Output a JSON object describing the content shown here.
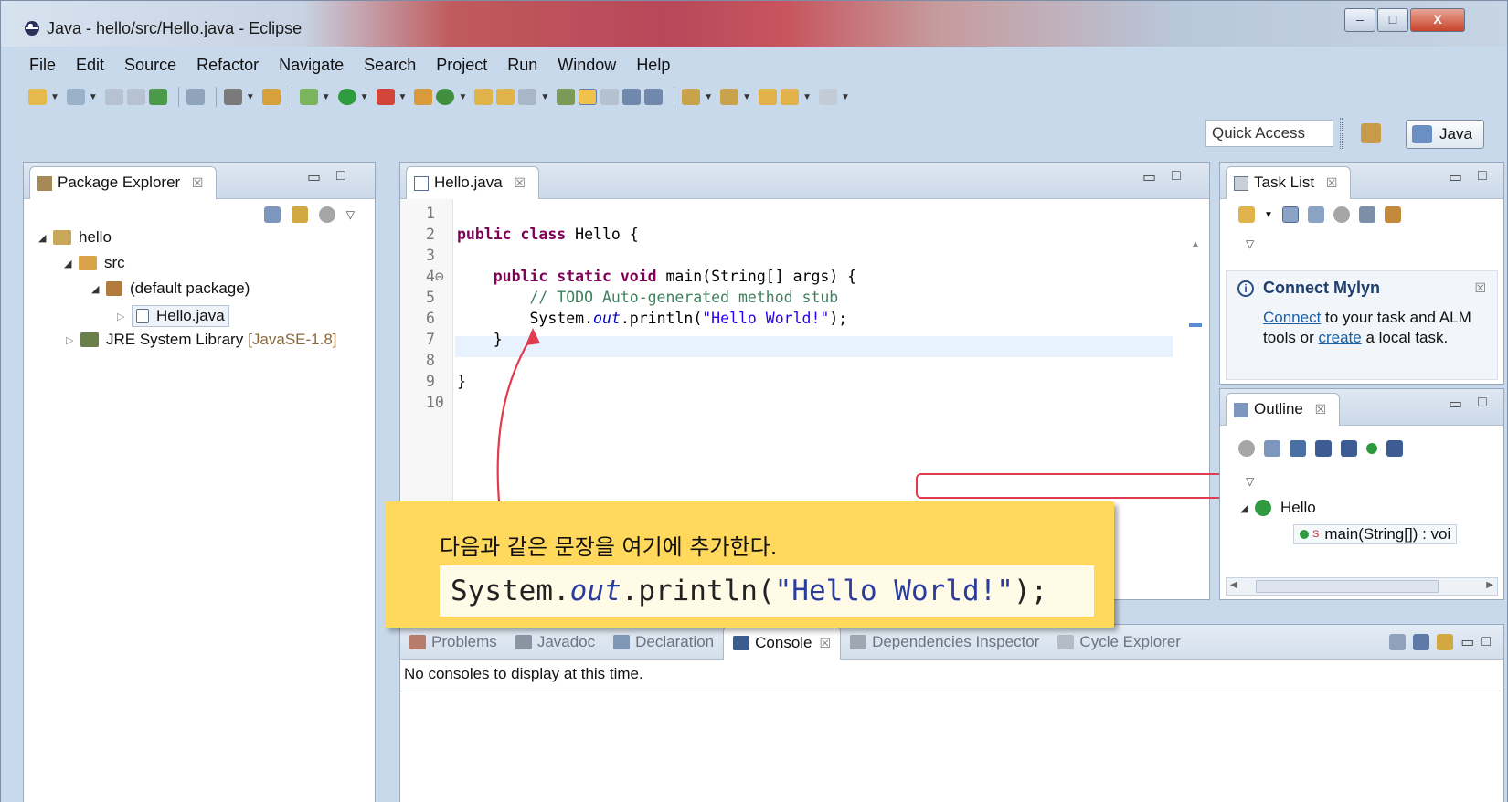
{
  "window": {
    "title": "Java - hello/src/Hello.java - Eclipse",
    "min_symbol": "‒",
    "max_symbol": "□",
    "close_symbol": "X"
  },
  "menu": [
    "File",
    "Edit",
    "Source",
    "Refactor",
    "Navigate",
    "Search",
    "Project",
    "Run",
    "Window",
    "Help"
  ],
  "toolbar": {
    "quick_access_placeholder": "Quick Access",
    "perspective_label": "Java"
  },
  "package_explorer": {
    "tab_label": "Package Explorer",
    "close_symbol": "☒",
    "tree": {
      "project": "hello",
      "src": "src",
      "package": "(default package)",
      "file": "Hello.java",
      "jre": "JRE System Library",
      "jre_version": "[JavaSE-1.8]"
    }
  },
  "editor": {
    "tab_label": "Hello.java",
    "lines": [
      {
        "n": "1"
      },
      {
        "n": "2",
        "kw": "public class ",
        "rest": "Hello {"
      },
      {
        "n": "3"
      },
      {
        "n": "4⊖",
        "kw": "public static void ",
        "rest": "main(String[] args) {"
      },
      {
        "n": "5",
        "comment": "// TODO Auto-generated method stub"
      },
      {
        "n": "6",
        "pre": "System.",
        "field": "out",
        "mid": ".println(",
        "str": "\"Hello World!\"",
        "post": ");"
      },
      {
        "n": "7",
        "rest": "}"
      },
      {
        "n": "8"
      },
      {
        "n": "9",
        "rest": "}"
      },
      {
        "n": "10"
      }
    ]
  },
  "task_list": {
    "tab_label": "Task List",
    "mylyn_title": "Connect Mylyn",
    "mylyn_link1": "Connect",
    "mylyn_text1": " to your task and ALM tools or ",
    "mylyn_link2": "create",
    "mylyn_text2": " a local task."
  },
  "outline": {
    "tab_label": "Outline",
    "class_name": "Hello",
    "method": "main(String[]) : voi"
  },
  "console": {
    "tabs": [
      "Problems",
      "Javadoc",
      "Declaration",
      "Console",
      "Dependencies Inspector",
      "Cycle Explorer"
    ],
    "active": "Console",
    "message": "No consoles to display at this time."
  },
  "callout": {
    "text": "다음과 같은 문장을 여기에 추가한다.",
    "code_pre": "System.",
    "code_field": "out",
    "code_mid": ".println(",
    "code_str": "\"Hello World!\"",
    "code_post": ");"
  },
  "colors": {
    "keyword": "#7f0055",
    "string": "#2a00ff",
    "field": "#0000c0",
    "comment": "#3f7f5f",
    "callout_bg": "#ffd85c",
    "callout_border": "#e03b4f"
  }
}
